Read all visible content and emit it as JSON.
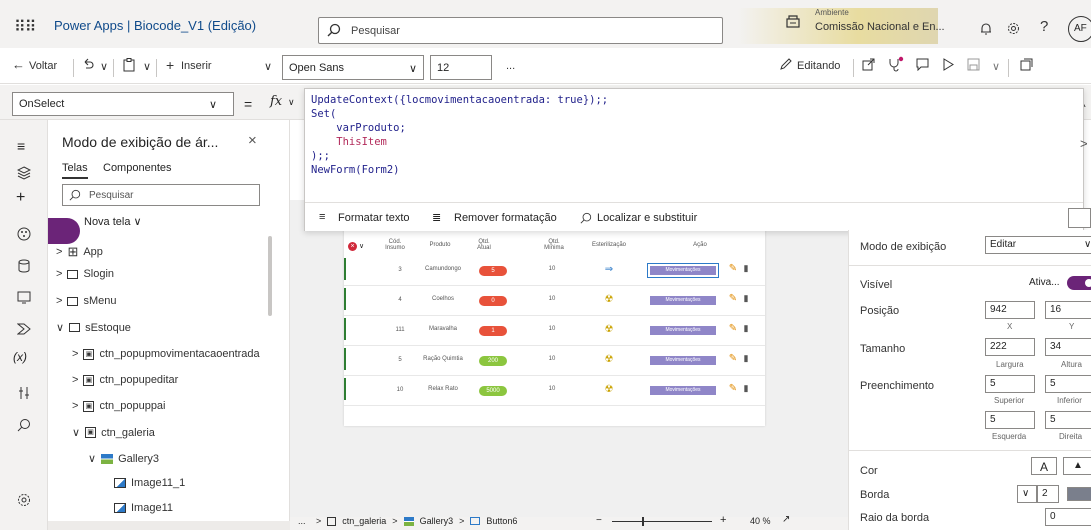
{
  "app": {
    "title": "Power Apps  |  Biocode_V1 (Edição)"
  },
  "search": {
    "placeholder": "Pesquisar"
  },
  "environment": {
    "label": "Ambiente",
    "value": "Comissão Nacional e En..."
  },
  "user": {
    "initials": "AF"
  },
  "toolbar": {
    "back": "Voltar",
    "insert": "Inserir",
    "font": "Open Sans",
    "size": "12",
    "more": "...",
    "editing": "Editando"
  },
  "formula": {
    "property": "OnSelect",
    "fx": "fx",
    "lines": [
      "UpdateContext({locmovimentacaoentrada: true});;",
      "Set(",
      "    varProduto;",
      "    ThisItem",
      ");;",
      "NewForm(Form2)"
    ],
    "format_text": "Formatar texto",
    "remove_format": "Remover formatação",
    "find_replace": "Localizar e substituir"
  },
  "tree": {
    "title": "Modo de exibição de ár...",
    "tab_screens": "Telas",
    "tab_components": "Componentes",
    "search_placeholder": "Pesquisar",
    "new_screen": "Nova tela",
    "items": [
      {
        "label": "App"
      },
      {
        "label": "Slogin"
      },
      {
        "label": "sMenu"
      },
      {
        "label": "sEstoque"
      },
      {
        "label": "ctn_popupmovimentacaoentrada"
      },
      {
        "label": "ctn_popupeditar"
      },
      {
        "label": "ctn_popuppai"
      },
      {
        "label": "ctn_galeria"
      },
      {
        "label": "Gallery3"
      },
      {
        "label": "Image11_1"
      },
      {
        "label": "Image11"
      }
    ]
  },
  "gallery": {
    "headers": [
      "Cód. Insumo",
      "Produto",
      "Qtd. Atual",
      "Qtd. Mínima",
      "Esterilização",
      "Ação"
    ],
    "rows": [
      {
        "code": "3",
        "product": "Camundongo",
        "current": "5",
        "min": "10",
        "color": "#e8523a"
      },
      {
        "code": "4",
        "product": "Coelhos",
        "current": "0",
        "min": "10",
        "color": "#e8523a"
      },
      {
        "code": "111",
        "product": "Maravalha",
        "current": "1",
        "min": "10",
        "color": "#e8523a"
      },
      {
        "code": "5",
        "product": "Ração Quimtia",
        "current": "200",
        "min": "10",
        "color": "#8cc63f"
      },
      {
        "code": "10",
        "product": "Relax Rato",
        "current": "5000",
        "min": "10",
        "color": "#8cc63f"
      }
    ],
    "button_label": "Movimentações"
  },
  "properties": {
    "display_mode_label": "Modo de exibição",
    "display_mode_value": "Editar",
    "visible_label": "Visível",
    "visible_value": "Ativa...",
    "position_label": "Posição",
    "x": "942",
    "y": "16",
    "x_label": "X",
    "y_label": "Y",
    "size_label": "Tamanho",
    "width": "222",
    "height": "34",
    "width_label": "Largura",
    "height_label": "Altura",
    "padding_label": "Preenchimento",
    "pad_top": "5",
    "pad_bottom": "5",
    "pad_left": "5",
    "pad_right": "5",
    "pad_top_label": "Superior",
    "pad_bottom_label": "Inferior",
    "pad_left_label": "Esquerda",
    "pad_right_label": "Direita",
    "color_label": "Cor",
    "color_a": "A",
    "border_label": "Borda",
    "border_value": "2",
    "radius_label": "Raio da borda",
    "radius_value": "0"
  },
  "statusbar": {
    "crumbs": [
      "ctn_galeria",
      "Gallery3",
      "Button6"
    ],
    "zoom": "40 %",
    "dots": "..."
  }
}
